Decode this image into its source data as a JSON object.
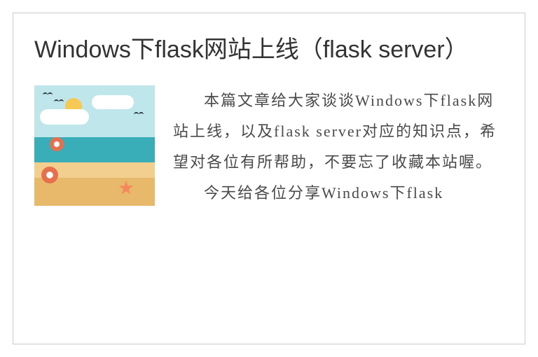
{
  "article": {
    "title": "Windows下flask网站上线（flask server）",
    "paragraphs": [
      "本篇文章给大家谈谈Windows下flask网站上线，以及flask server对应的知识点，希望对各位有所帮助，不要忘了收藏本站喔。",
      "今天给各位分享Windows下flask"
    ]
  }
}
